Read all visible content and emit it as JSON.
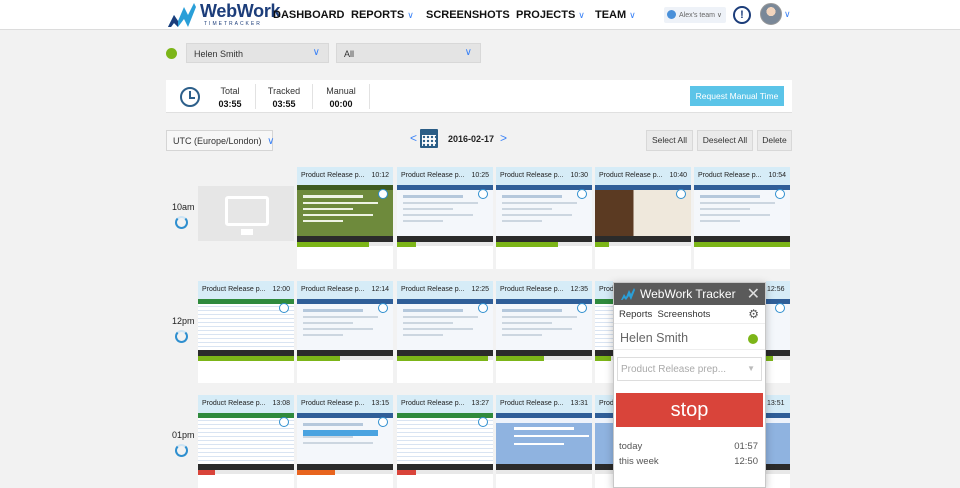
{
  "nav": {
    "logo_name": "WebWork",
    "logo_sub": "TIMETRACKER",
    "items": [
      "DASHBOARD",
      "REPORTS",
      "SCREENSHOTS",
      "PROJECTS",
      "TEAM"
    ],
    "team_label": "Alex's team",
    "alert_glyph": "!"
  },
  "filters": {
    "user_select": "Helen Smith",
    "project_select": "All"
  },
  "totals": {
    "total_label": "Total",
    "total_value": "03:55",
    "tracked_label": "Tracked",
    "tracked_value": "03:55",
    "manual_label": "Manual",
    "manual_value": "00:00",
    "request_button": "Request Manual Time"
  },
  "toolbar": {
    "timezone": "UTC (Europe/London)",
    "date": "2016-02-17",
    "prev": "<",
    "next": ">",
    "select_all": "Select All",
    "deselect_all": "Deselect All",
    "delete": "Delete"
  },
  "rows": [
    {
      "hour": "10am",
      "shots": [
        {
          "task": "Product Release p...",
          "time": "10:12",
          "activity": 0.75,
          "color": "#7cb518"
        },
        {
          "task": "Product Release p...",
          "time": "10:25",
          "activity": 0.2,
          "color": "#7cb518"
        },
        {
          "task": "Product Release p...",
          "time": "10:30",
          "activity": 0.65,
          "color": "#7cb518"
        },
        {
          "task": "Product Release p...",
          "time": "10:40",
          "activity": 0.15,
          "color": "#7cb518"
        },
        {
          "task": "Product Release p...",
          "time": "10:54",
          "activity": 1.0,
          "color": "#7cb518"
        }
      ]
    },
    {
      "hour": "12pm",
      "shots": [
        {
          "task": "Product Release p...",
          "time": "12:00",
          "activity": 1.0,
          "color": "#7cb518"
        },
        {
          "task": "Product Release p...",
          "time": "12:14",
          "activity": 0.45,
          "color": "#7cb518"
        },
        {
          "task": "Product Release p...",
          "time": "12:25",
          "activity": 0.95,
          "color": "#7cb518"
        },
        {
          "task": "Product Release p...",
          "time": "12:35",
          "activity": 0.5,
          "color": "#7cb518"
        },
        {
          "task": "Prod",
          "time": "",
          "activity": 0.9,
          "color": "#7cb518"
        },
        {
          "task": "",
          "time": "12:56",
          "activity": 0.3,
          "color": "#7cb518"
        }
      ]
    },
    {
      "hour": "01pm",
      "shots": [
        {
          "task": "Product Release p...",
          "time": "13:08",
          "activity": 0.18,
          "color": "#d9443a"
        },
        {
          "task": "Product Release p...",
          "time": "13:15",
          "activity": 0.4,
          "color": "#e8641e"
        },
        {
          "task": "Product Release p...",
          "time": "13:27",
          "activity": 0.2,
          "color": "#d9443a"
        },
        {
          "task": "Product Release p...",
          "time": "13:31",
          "activity": 0.0,
          "color": "#7cb518"
        },
        {
          "task": "Prod",
          "time": "",
          "activity": 0.0,
          "color": "#7cb518"
        },
        {
          "task": "",
          "time": "13:51",
          "activity": 0.0,
          "color": "#7cb518"
        }
      ]
    }
  ],
  "tracker": {
    "title": "WebWork Tracker",
    "tab_reports": "Reports",
    "tab_screenshots": "Screenshots",
    "user": "Helen Smith",
    "task_placeholder": "Product Release prep...",
    "stop_label": "stop",
    "today_label": "today",
    "today_value": "01:57",
    "week_label": "this week",
    "week_value": "12:50"
  }
}
